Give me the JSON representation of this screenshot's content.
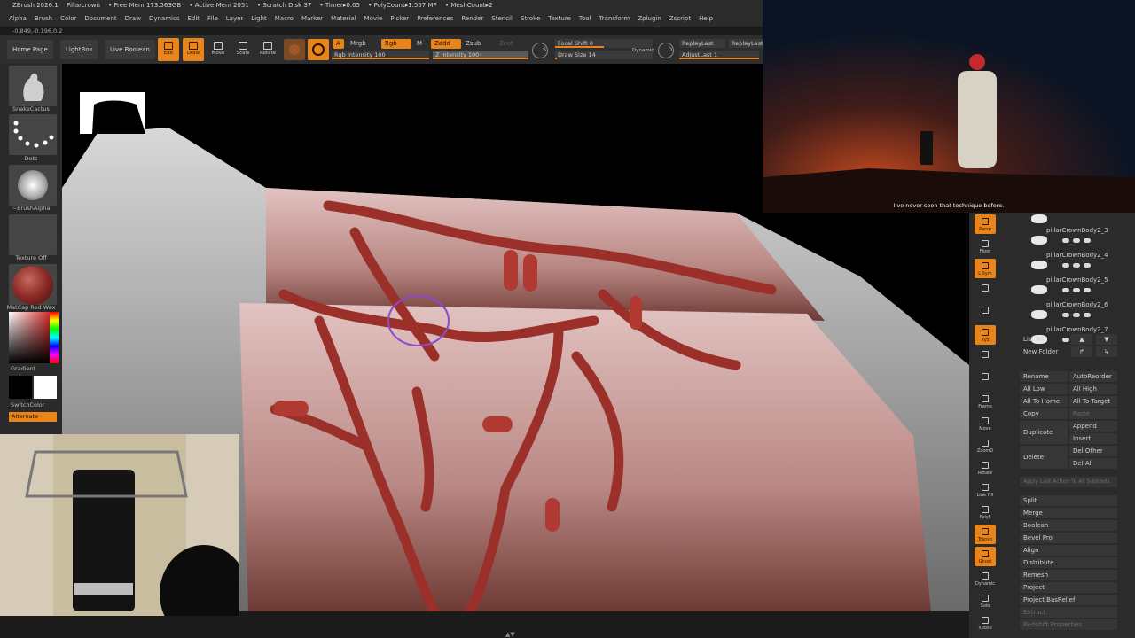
{
  "titlebar": {
    "app": "ZBrush 2026.1",
    "doc": "Pillarcrown",
    "free_mem": "• Free Mem 173.563GB",
    "active_mem": "• Active Mem 2051",
    "scratch": "• Scratch Disk 37",
    "timer": "• Timer▸0.05",
    "polycount": "• PolyCount▸1.557 MP",
    "meshcount": "• MeshCount▸2"
  },
  "menu": [
    "Alpha",
    "Brush",
    "Color",
    "Document",
    "Draw",
    "Dynamics",
    "Edit",
    "File",
    "Layer",
    "Light",
    "Macro",
    "Marker",
    "Material",
    "Movie",
    "Picker",
    "Preferences",
    "Render",
    "Stencil",
    "Stroke",
    "Texture",
    "Tool",
    "Transform",
    "Zplugin",
    "Zscript",
    "Help"
  ],
  "coords": "-0.849,-0.196,0.2",
  "toolbar": {
    "home": "Home Page",
    "lightbox": "LightBox",
    "live_boolean": "Live Boolean",
    "edit": "Edit",
    "draw": "Draw",
    "move": "Move",
    "scale": "Scale",
    "rotate": "Rotate",
    "a": "A",
    "mrgb": "Mrgb",
    "rgb": "Rgb",
    "m": "M",
    "zadd": "Zadd",
    "zsub": "Zsub",
    "zcut": "Zcut",
    "rgb_intensity_label": "Rgb Intensity",
    "rgb_intensity": "100",
    "z_intensity_label": "Z Intensity",
    "z_intensity": "100",
    "s": "S",
    "d": "D",
    "focal_shift_label": "Focal Shift",
    "focal_shift": "0",
    "draw_size_label": "Draw Size",
    "draw_size": "14",
    "dynamic": "Dynamic",
    "replaylast": "ReplayLast",
    "replaylast2": "ReplayLast",
    "adjustlast_label": "AdjustLast",
    "adjustlast": "1"
  },
  "left": {
    "brush": "SnakeCactus",
    "stroke": "Dots",
    "alpha": "~BrushAlpha",
    "texture": "Texture Off",
    "material": "MatCap Red Wax",
    "gradient": "Gradient",
    "switchcolor": "SwitchColor",
    "alternate": "Alternate"
  },
  "video": {
    "subtitle": "I've never seen that technique before."
  },
  "icons": [
    "Persp",
    "Floor",
    "L.Sym",
    "",
    "",
    "Xyz",
    "",
    "",
    "Frame",
    "Move",
    "ZoomD",
    "Rotate",
    "Line Fill",
    "PolyF",
    "Transp",
    "Ghost",
    "Dynamic",
    "Solo",
    "Xpose"
  ],
  "subtools": [
    "pillarCrownBody2_3",
    "pillarCrownBody2_4",
    "pillarCrownBody2_5",
    "pillarCrownBody2_6",
    "pillarCrownBody2_7"
  ],
  "right": {
    "list_all": "List All",
    "new_folder": "New Folder",
    "rename": "Rename",
    "autoreorder": "AutoReorder",
    "all_low": "All Low",
    "all_high": "All High",
    "all_to_home": "All To Home",
    "all_to_target": "All To Target",
    "copy": "Copy",
    "paste": "Paste",
    "duplicate": "Duplicate",
    "append": "Append",
    "insert": "Insert",
    "delete": "Delete",
    "del_other": "Del Other",
    "del_all": "Del All",
    "apply_last": "Apply Last Action To All Subtools",
    "split": "Split",
    "merge": "Merge",
    "boolean": "Boolean",
    "bevel_pro": "Bevel Pro",
    "align": "Align",
    "distribute": "Distribute",
    "remesh": "Remesh",
    "project": "Project",
    "project_basrelief": "Project BasRelief",
    "extract": "Extract",
    "redshift": "Redshift Properties"
  },
  "colors": {
    "accent": "#e8841a",
    "panel": "#2b2b2b",
    "wax": "#8e2a26"
  }
}
